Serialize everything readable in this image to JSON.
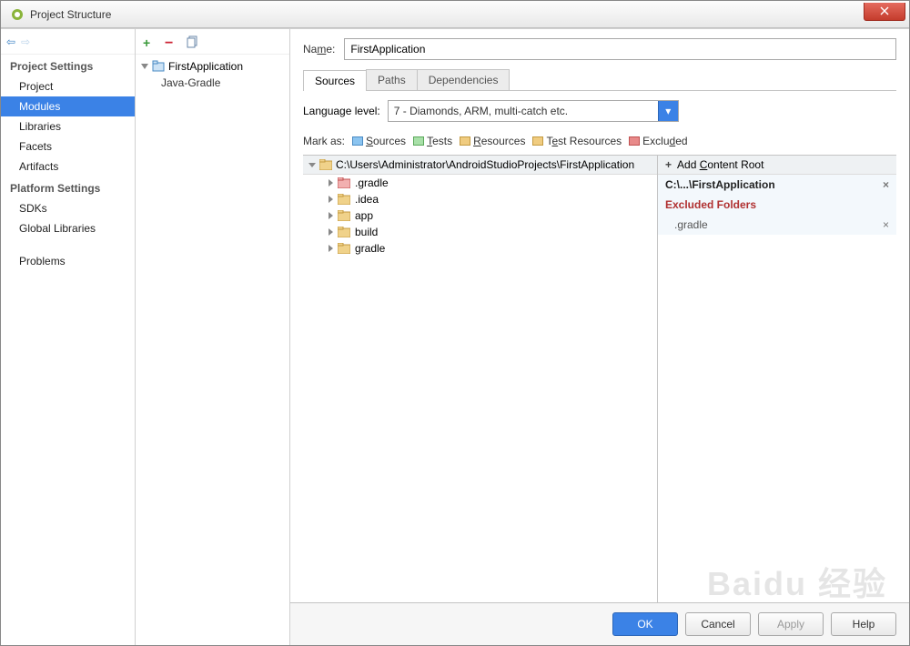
{
  "title": "Project Structure",
  "leftnav": {
    "section1": "Project Settings",
    "items1": [
      "Project",
      "Modules",
      "Libraries",
      "Facets",
      "Artifacts"
    ],
    "selected": "Modules",
    "section2": "Platform Settings",
    "items2": [
      "SDKs",
      "Global Libraries"
    ],
    "section3": "",
    "items3": [
      "Problems"
    ]
  },
  "tree": {
    "root": "FirstApplication",
    "child": "Java-Gradle"
  },
  "form": {
    "name_label_pre": "Na",
    "name_label_ul": "m",
    "name_label_post": "e:",
    "name_value": "FirstApplication"
  },
  "tabs": [
    "Sources",
    "Paths",
    "Dependencies"
  ],
  "lang_level": {
    "label": "Language level:",
    "value": "7 - Diamonds, ARM, multi-catch etc."
  },
  "mark_as": {
    "label": "Mark as:",
    "sources": "Sources",
    "tests": "Tests",
    "resources": "Resources",
    "testres": "Test Resources",
    "excluded": "Excluded"
  },
  "folders": {
    "root": "C:\\Users\\Administrator\\AndroidStudioProjects\\FirstApplication",
    "items": [
      ".gradle",
      ".idea",
      "app",
      "build",
      "gradle"
    ],
    "excluded": [
      ".gradle"
    ]
  },
  "content_root": {
    "add_label": "Add Content Root",
    "path": "C:\\...\\FirstApplication",
    "excluded_header": "Excluded Folders",
    "excluded_item": ".gradle"
  },
  "buttons": {
    "ok": "OK",
    "cancel": "Cancel",
    "apply": "Apply",
    "help": "Help"
  },
  "watermark": "Baidu 经验"
}
